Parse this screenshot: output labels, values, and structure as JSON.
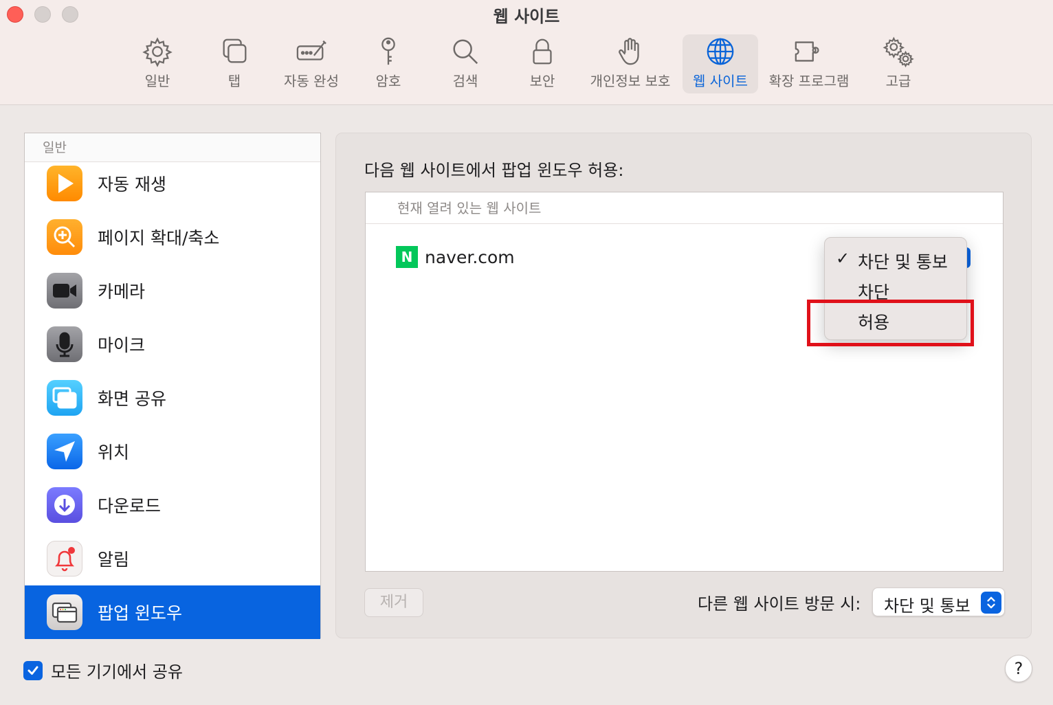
{
  "window": {
    "title": "웹 사이트"
  },
  "toolbar": {
    "items": [
      {
        "label": "일반",
        "icon": "gear-icon"
      },
      {
        "label": "탭",
        "icon": "tabs-icon"
      },
      {
        "label": "자동 완성",
        "icon": "autofill-icon"
      },
      {
        "label": "암호",
        "icon": "key-icon"
      },
      {
        "label": "검색",
        "icon": "magnifier-icon"
      },
      {
        "label": "보안",
        "icon": "lock-icon"
      },
      {
        "label": "개인정보 보호",
        "icon": "hand-icon"
      },
      {
        "label": "웹 사이트",
        "icon": "globe-icon",
        "active": true
      },
      {
        "label": "확장 프로그램",
        "icon": "puzzle-icon"
      },
      {
        "label": "고급",
        "icon": "gears-icon"
      }
    ]
  },
  "sidebar": {
    "header": "일반",
    "items": [
      {
        "label": "자동 재생",
        "icon": "play-icon"
      },
      {
        "label": "페이지 확대/축소",
        "icon": "zoom-icon"
      },
      {
        "label": "카메라",
        "icon": "camera-icon"
      },
      {
        "label": "마이크",
        "icon": "microphone-icon"
      },
      {
        "label": "화면 공유",
        "icon": "screen-share-icon"
      },
      {
        "label": "위치",
        "icon": "location-icon"
      },
      {
        "label": "다운로드",
        "icon": "download-icon"
      },
      {
        "label": "알림",
        "icon": "bell-icon"
      },
      {
        "label": "팝업 윈도우",
        "icon": "popup-window-icon",
        "selected": true
      }
    ]
  },
  "main": {
    "title": "다음 웹 사이트에서 팝업 윈도우 허용:",
    "list_header": "현재 열려 있는 웹 사이트",
    "sites": [
      {
        "name": "naver.com",
        "logo_letter": "N",
        "setting": "차단 및 통보"
      }
    ],
    "remove_button": "제거",
    "other_sites_label": "다른 웹 사이트 방문 시:",
    "other_sites_value": "차단 및 통보"
  },
  "menu": {
    "checkmark": "✓",
    "options": [
      {
        "label": "차단 및 통보",
        "checked": true
      },
      {
        "label": "차단",
        "checked": false
      },
      {
        "label": "허용",
        "checked": false,
        "highlighted": true
      }
    ]
  },
  "footer": {
    "share_label": "모든 기기에서 공유",
    "share_checked": true,
    "help": "?"
  },
  "colors": {
    "accent": "#0a64e0",
    "highlight_box": "#e0111a",
    "naver_green": "#03c75a"
  }
}
